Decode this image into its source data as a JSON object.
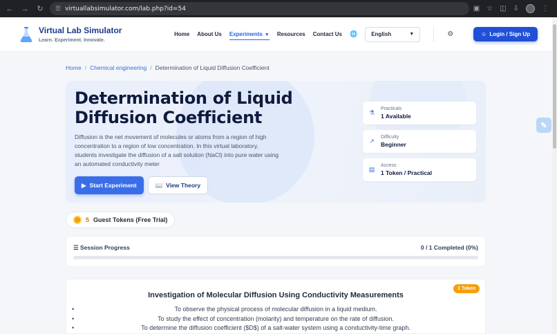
{
  "browser": {
    "url": "virtuallabsimulator.com/lab.php?id=54",
    "icons": [
      "back-icon",
      "forward-icon",
      "reload-icon",
      "site-settings-icon",
      "install-app-icon",
      "bookmark-star-icon",
      "extensions-icon",
      "download-icon",
      "profile-icon",
      "menu-icon"
    ]
  },
  "header": {
    "brand_title": "Virtual Lab Simulator",
    "brand_tagline": "Learn. Experiment. Innovate.",
    "nav": {
      "home": "Home",
      "about": "About Us",
      "experiments": "Experiments",
      "resources": "Resources",
      "contact": "Contact Us"
    },
    "language": "English",
    "login_label": "Login / Sign Up",
    "accent_color": "#2150d6"
  },
  "breadcrumb": {
    "home": "Home",
    "category": "Chemical engineering",
    "current": "Determination of Liquid Diffusion Coefficient"
  },
  "hero": {
    "title": "Determination of Liquid Diffusion Coefficient",
    "description": "Diffusion is the net movement of molecules or atoms from a region of high concentration to a region of low concentration. In this virtual laboratory, students investigate the diffusion of a salt solution (NaCl) into pure water using an automated conductivity meter",
    "start_label": "Start Experiment",
    "theory_label": "View Theory",
    "meta": {
      "practicals_label": "Practicals",
      "practicals_value": "1 Available",
      "difficulty_label": "Difficulty",
      "difficulty_value": "Beginner",
      "access_label": "Access",
      "access_value": "1 Token / Practical"
    }
  },
  "tokens": {
    "count": "5",
    "label": "Guest Tokens (Free Trial)"
  },
  "session": {
    "label": "Session Progress",
    "stat": "0 / 1 Completed (0%)",
    "progress_fraction": 0
  },
  "experiment": {
    "title": "Investigation of Molecular Diffusion Using Conductivity Measurements",
    "badge": "1 Token",
    "objectives": [
      "To observe the physical process of molecular diffusion in a liquid medium.",
      "To study the effect of concentration (molarity) and temperature on the rate of diffusion.",
      "To determine the diffusion coefficient ($D$) of a salt-water system using a conductivity-time graph."
    ]
  }
}
